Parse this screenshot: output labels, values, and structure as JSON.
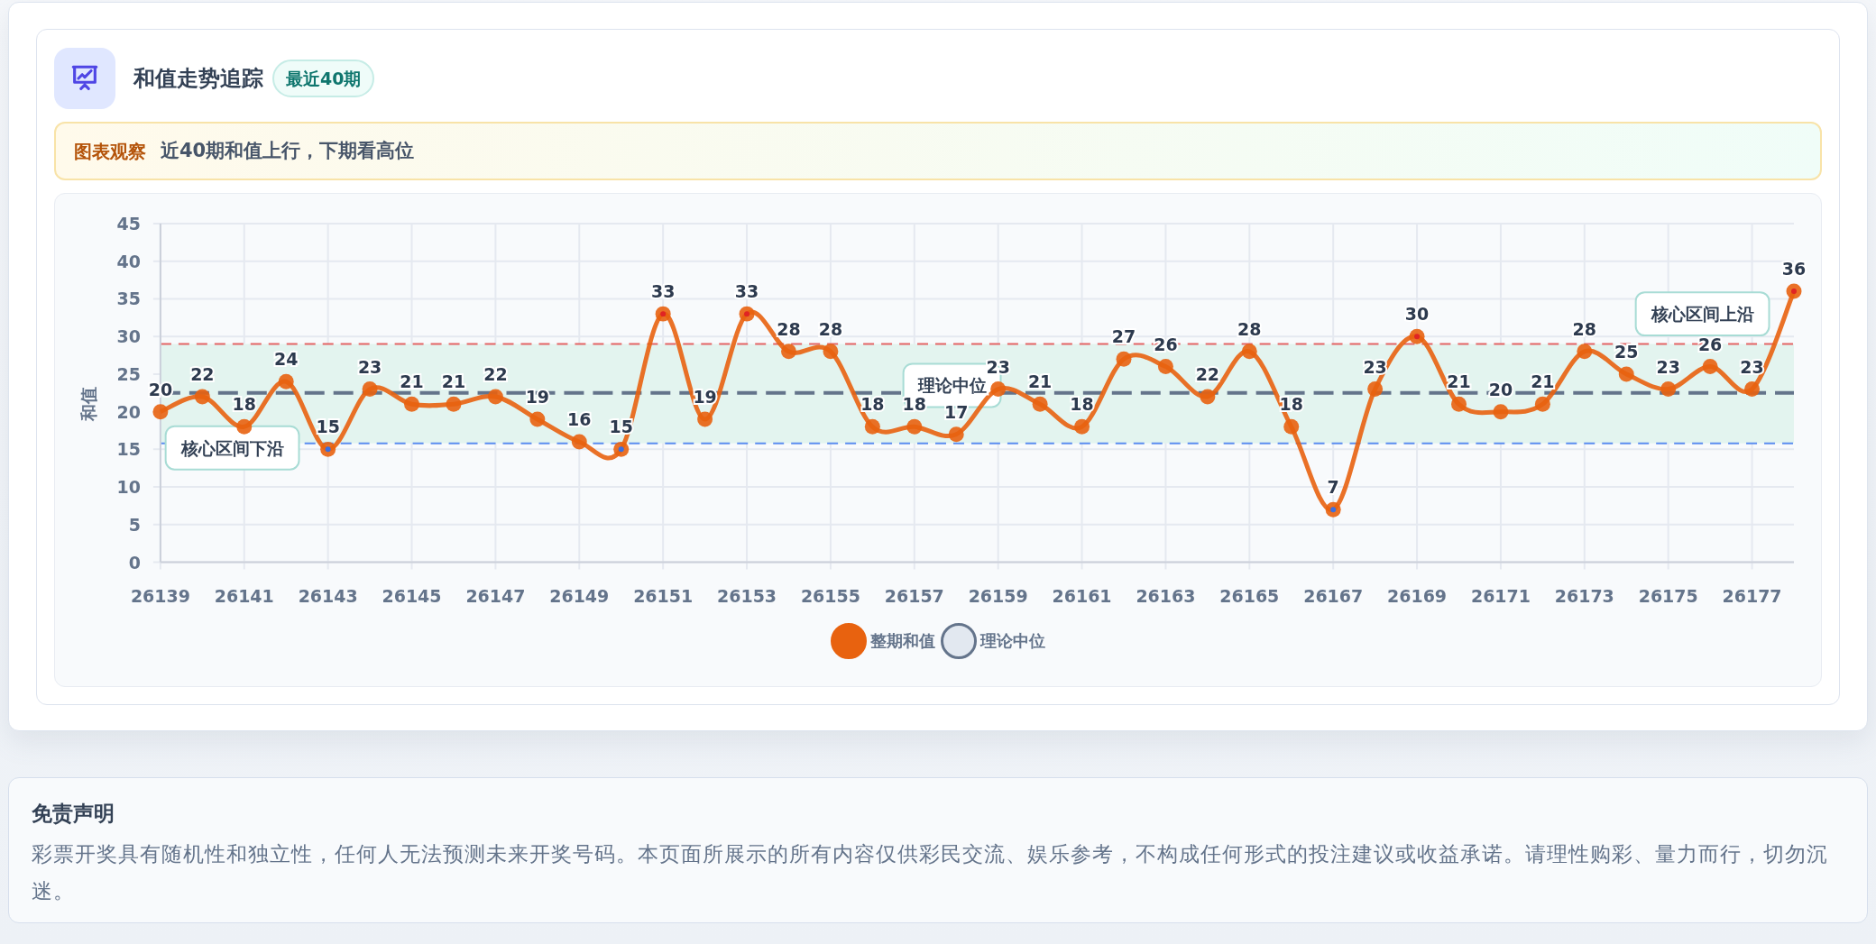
{
  "header": {
    "title": "和值走势追踪",
    "badge": "最近40期"
  },
  "insight": {
    "label": "图表观察",
    "text": "近40期和值上行，下期看高位"
  },
  "chart": {
    "chart_data": {
      "type": "line",
      "ylabel": "和值",
      "x": [
        26139,
        26140,
        26141,
        26142,
        26143,
        26144,
        26145,
        26146,
        26147,
        26148,
        26149,
        26150,
        26151,
        26152,
        26153,
        26154,
        26155,
        26156,
        26157,
        26158,
        26159,
        26160,
        26161,
        26162,
        26163,
        26164,
        26165,
        26166,
        26167,
        26168,
        26169,
        26170,
        26171,
        26172,
        26173,
        26174,
        26175,
        26176,
        26177,
        26178
      ],
      "series": [
        {
          "name": "整期和值",
          "color": "#e8620f",
          "marker": "circle",
          "line_style": "solid",
          "values": [
            20,
            22,
            18,
            24,
            15,
            23,
            21,
            21,
            22,
            19,
            16,
            15,
            33,
            19,
            33,
            28,
            28,
            18,
            18,
            17,
            23,
            21,
            18,
            27,
            26,
            22,
            28,
            18,
            7,
            23,
            30,
            21,
            20,
            21,
            28,
            25,
            23,
            26,
            23,
            36
          ]
        }
      ],
      "ref_lines": [
        {
          "axis": "y",
          "value": 29,
          "color": "#e36464",
          "line_style": "dashed"
        },
        {
          "axis": "y",
          "value": 15.8,
          "color": "#5b8def",
          "line_style": "dashed"
        },
        {
          "axis": "y",
          "value": 22.5,
          "label": "理论中位",
          "color": "#64748b",
          "line_style": "dashed"
        }
      ],
      "xlim": [
        26139,
        26178
      ],
      "ylim": [
        0,
        45
      ],
      "yticks": [
        0,
        5,
        10,
        15,
        20,
        25,
        30,
        35,
        40,
        45
      ],
      "xticks": [
        26139,
        26141,
        26143,
        26145,
        26147,
        26149,
        26151,
        26153,
        26155,
        26157,
        26159,
        26161,
        26163,
        26165,
        26167,
        26169,
        26171,
        26173,
        26175,
        26177
      ],
      "grid": true,
      "legend": true,
      "data_labels": true,
      "annotations": [
        "核心区间上沿",
        "核心区间下沿",
        "理论中位"
      ]
    }
  },
  "disclaimer": {
    "title": "免责声明",
    "text": "彩票开奖具有随机性和独立性，任何人无法预测未来开奖号码。本页面所展示的所有内容仅供彩民交流、娱乐参考，不构成任何形式的投注建议或收益承诺。请理性购彩、量力而行，切勿沉迷。"
  }
}
